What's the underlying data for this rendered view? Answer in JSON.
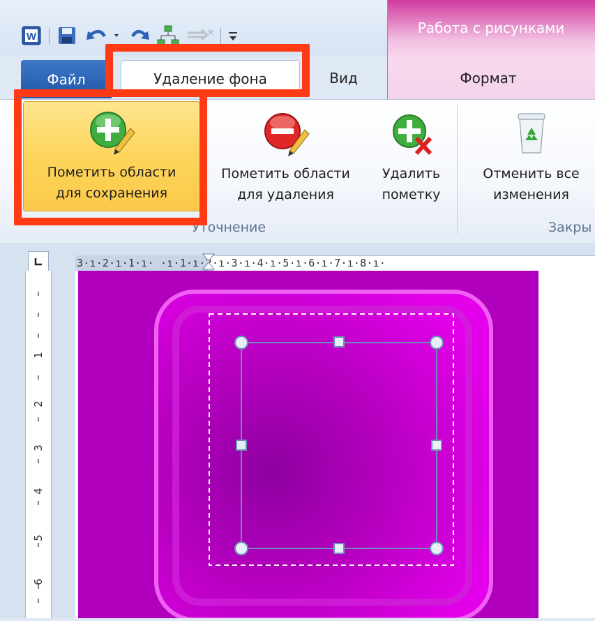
{
  "window": {
    "contextual_title": "Работа с рисунками"
  },
  "quick_access": {
    "icons": [
      "word-app-icon",
      "save-icon",
      "undo-icon",
      "redo-icon",
      "hierarchy-icon",
      "arrows-icon",
      "customize-icon"
    ]
  },
  "tabs": {
    "file": "Файл",
    "background_removal": "Удаление фона",
    "view": "Вид",
    "format": "Формат"
  },
  "ribbon": {
    "mark_keep": {
      "line1": "Пометить области",
      "line2": "для сохранения"
    },
    "mark_remove": {
      "line1": "Пометить области",
      "line2": "для удаления"
    },
    "delete_mark": {
      "line1": "Удалить",
      "line2": "пометку"
    },
    "discard_all": {
      "line1": "Отменить все",
      "line2": "изменения"
    },
    "group_refine": "Уточнение",
    "group_close": "Закры"
  },
  "ruler": {
    "horizontal": "3·ı·2·ı·1·ı· ·ı·1·ı·2·ı·3·ı·4·ı·5·ı·6·ı·7·ı·8·ı·",
    "vertical_marks": [
      "1",
      "2",
      "3",
      "4",
      "5",
      "6"
    ]
  },
  "colors": {
    "highlight": "#ff3a14",
    "image_magenta": "#c908cd",
    "contextual_pink": "#d03a9e"
  }
}
